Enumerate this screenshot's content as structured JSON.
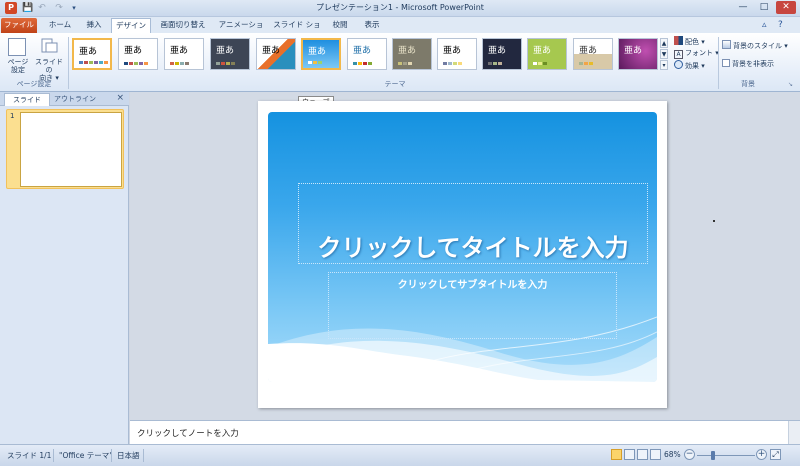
{
  "window": {
    "title": "プレゼンテーション1 - Microsoft PowerPoint",
    "app_logo": "P",
    "min": "—",
    "max": "□",
    "close": "✕"
  },
  "tabs": [
    {
      "label": "ファイル"
    },
    {
      "label": "ホーム"
    },
    {
      "label": "挿入"
    },
    {
      "label": "デザイン"
    },
    {
      "label": "画面切り替え"
    },
    {
      "label": "アニメーション"
    },
    {
      "label": "スライド ショー"
    },
    {
      "label": "校閲"
    },
    {
      "label": "表示"
    }
  ],
  "ribbon": {
    "page_setup": {
      "btn1_line1": "ページ",
      "btn1_line2": "設定",
      "btn2_line1": "スライドの",
      "btn2_line2": "向き ▾",
      "group_label": "ページ設定"
    },
    "themes": {
      "group_label": "テーマ",
      "sample_text": "亜あ",
      "hovered_name": "ウェーブ"
    },
    "theme_options": {
      "colors": "配色 ▾",
      "fonts": "フォント ▾",
      "effects": "効果 ▾"
    },
    "background": {
      "styles": "背景のスタイル ▾",
      "hide": "背景を非表示",
      "group_label": "背景"
    }
  },
  "left_pane": {
    "tab_slides": "スライド",
    "tab_outline": "アウトライン",
    "close": "×",
    "thumb_number": "1"
  },
  "slide": {
    "title": "クリックしてタイトルを入力",
    "subtitle": "クリックしてサブタイトルを入力"
  },
  "notes": {
    "placeholder": "クリックしてノートを入力"
  },
  "status": {
    "slide_pos": "スライド 1/1",
    "theme": "\"Office テーマ\"",
    "language": "日本語",
    "zoom": "68%",
    "zoom_minus": "−",
    "zoom_plus": "+",
    "zoom_level": 0.27
  }
}
